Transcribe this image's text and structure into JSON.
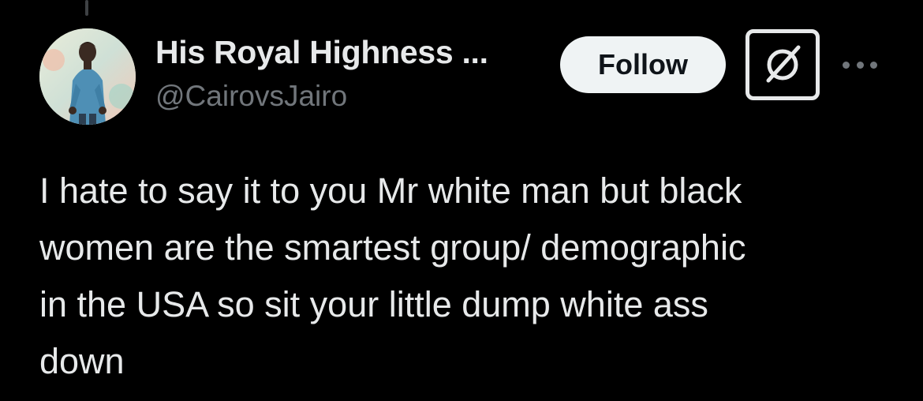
{
  "author": {
    "display_name": "His Royal Highness ...",
    "handle": "@CairovsJairo"
  },
  "actions": {
    "follow_label": "Follow",
    "grok_icon": "grok-slash-icon",
    "more_icon": "more-dots-icon"
  },
  "tweet": {
    "text": "I hate to say it to you Mr white man but black\nwomen are the smartest group/ demographic\nin the USA so sit your little dump white ass\ndown"
  },
  "colors": {
    "background": "#000000",
    "primary_text": "#e7e9ea",
    "secondary_text": "#71767b",
    "follow_bg": "#eff3f4"
  }
}
